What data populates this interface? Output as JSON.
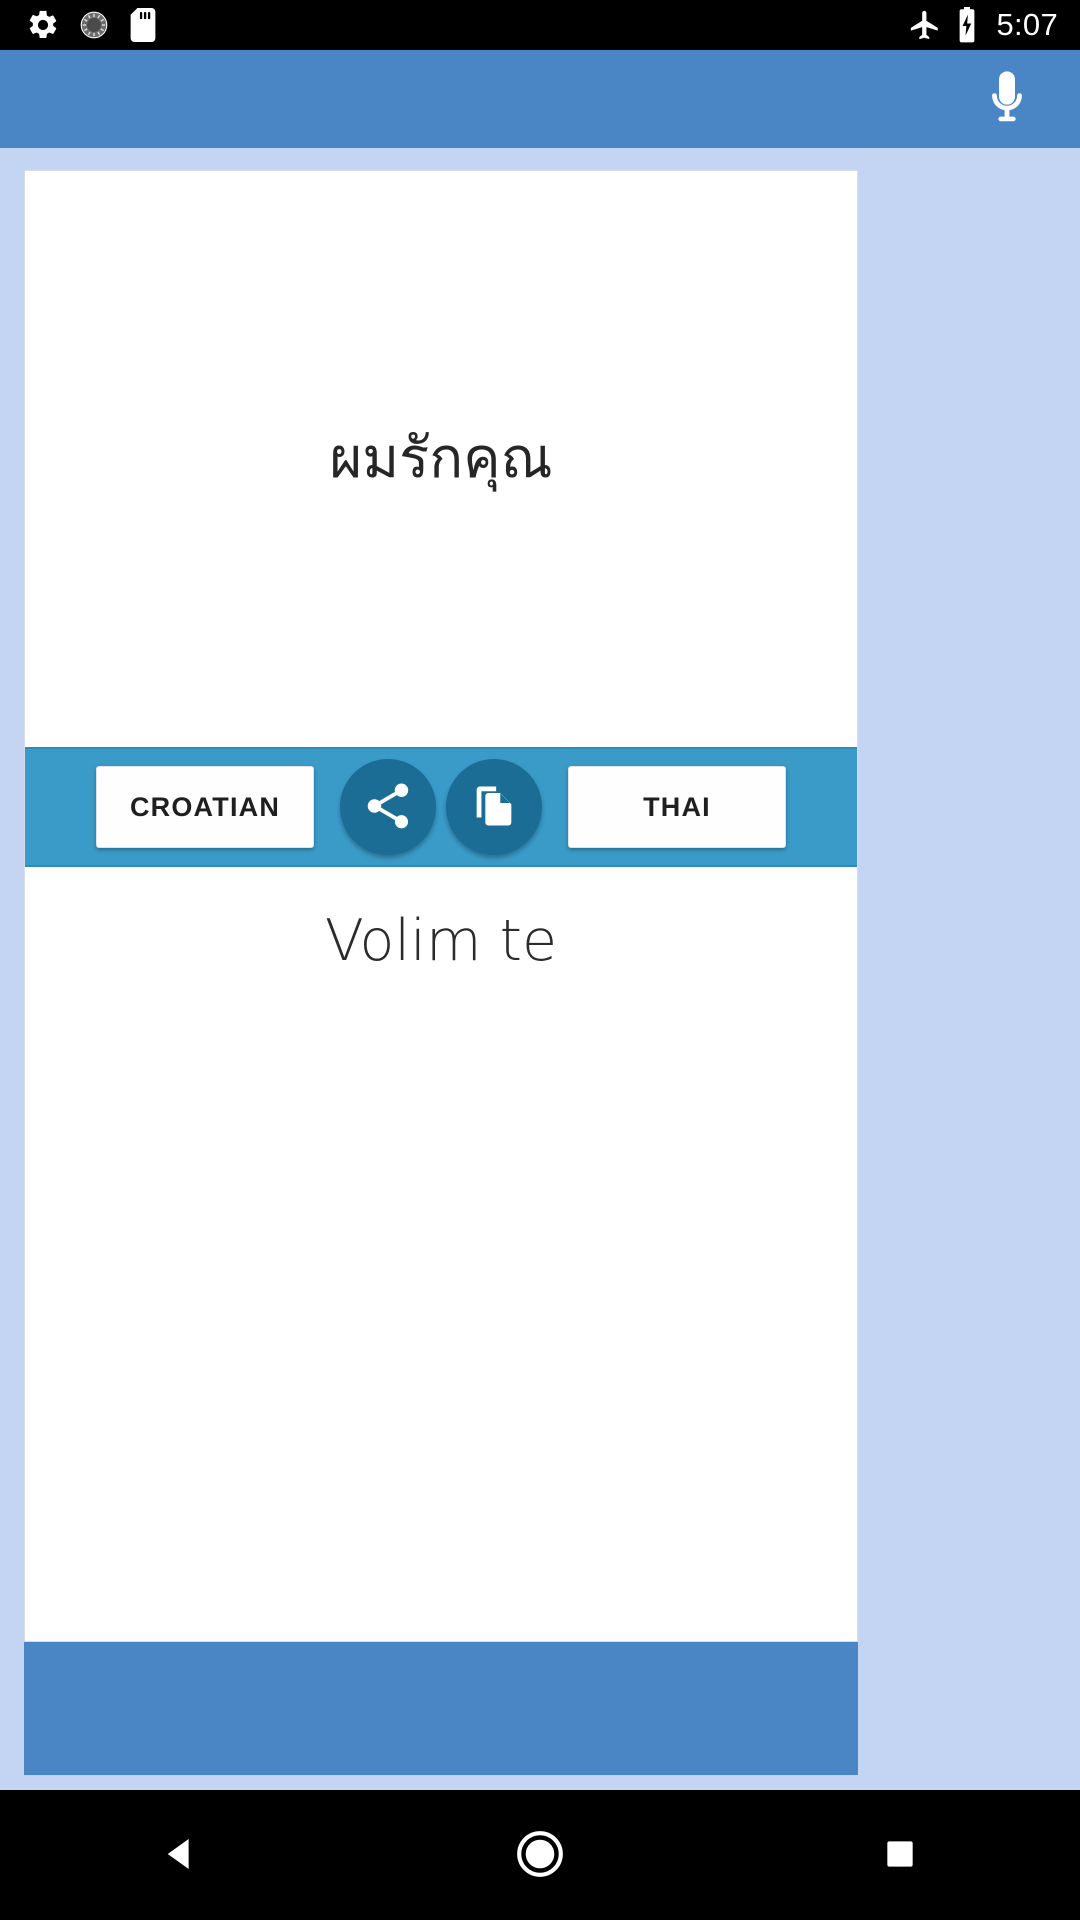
{
  "status_bar": {
    "time": "5:07",
    "left_icons": [
      "settings-gear-icon",
      "rotary-dial-icon",
      "sd-card-icon"
    ],
    "right_icons": [
      "airplane-mode-icon",
      "battery-charging-icon"
    ],
    "background_color": "#000000",
    "foreground_color": "#ffffff"
  },
  "app_bar": {
    "background_color": "#4a85c5",
    "mic_icon": "microphone-icon",
    "title": ""
  },
  "translator": {
    "source": {
      "text": "ผมรักคุณ",
      "language_label": "THAI"
    },
    "target": {
      "text": "Volim te",
      "language_label": "CROATIAN"
    },
    "toolbar": {
      "background_color": "#3a9bc9",
      "left_language_button": "CROATIAN",
      "right_language_button": "THAI",
      "share_icon": "share-icon",
      "copy_icon": "copy-icon",
      "action_circle_color": "#1b6d95"
    }
  },
  "page": {
    "background_color": "#c3d5f2",
    "card_background_color": "#ffffff",
    "footer_color": "#4a85c5"
  },
  "nav_bar": {
    "background_color": "#000000",
    "back_label": "Back",
    "home_label": "Home",
    "recents_label": "Recents"
  }
}
